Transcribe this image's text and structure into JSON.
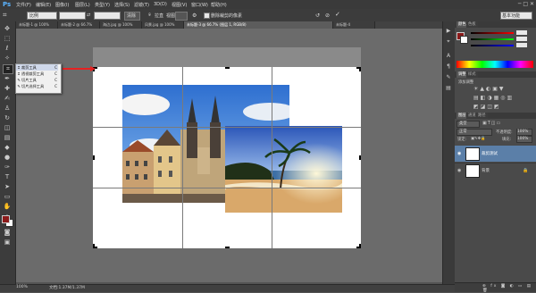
{
  "app": {
    "logo": "Ps"
  },
  "menu": [
    "文件(F)",
    "编辑(E)",
    "图像(I)",
    "图层(L)",
    "类型(Y)",
    "选择(S)",
    "滤镜(T)",
    "3D(D)",
    "视图(V)",
    "窗口(W)",
    "帮助(H)"
  ],
  "window_controls": "─ □ ✕",
  "options": {
    "ratio": "比例",
    "clear_label": "清除",
    "straighten_label": "拉直",
    "view_label": "视图",
    "delete_crop_label": "删除裁剪的像素",
    "confirm_icon": "check-icon",
    "cancel_icon": "cancel-icon",
    "reset_icon": "reset-icon",
    "mode_label": "基本功能"
  },
  "tabs": [
    {
      "label": "未标题-1 @ 100% (RGB/8)",
      "active": false
    },
    {
      "label": "未标题-2 @ 66.7% (RGB/8)",
      "active": false
    },
    {
      "label": "海边.jpg @ 100% (RGB/8)",
      "active": false
    },
    {
      "label": "风景.jpg @ 100% (RGB/8)",
      "active": false
    },
    {
      "label": "未标题-3 @ 66.7% (图层 1, RGB/8)",
      "active": true
    },
    {
      "label": "未标题-4",
      "active": false
    }
  ],
  "crop_flyout": {
    "items": [
      {
        "icon": "crop-icon",
        "glyph": "⌗",
        "label": "裁剪工具",
        "key": "C",
        "selected": true
      },
      {
        "icon": "perspective-crop-icon",
        "glyph": "⌗",
        "label": "透视裁剪工具",
        "key": "C",
        "selected": false
      },
      {
        "icon": "slice-icon",
        "glyph": "✎",
        "label": "切片工具",
        "key": "C",
        "selected": false
      },
      {
        "icon": "slice-select-icon",
        "glyph": "✎",
        "label": "切片选择工具",
        "key": "C",
        "selected": false
      }
    ]
  },
  "status": {
    "zoom": "100%",
    "doc": "文档:1.37M/1.37M"
  },
  "panels": {
    "color_tabs": [
      "颜色",
      "色板"
    ],
    "adjust_tabs": [
      "调整",
      "样式"
    ],
    "adjust_title": "添加调整",
    "layers_tabs": [
      "图层",
      "通道",
      "路径"
    ],
    "kind": "类型",
    "blend": "正常",
    "opacity_label": "不透明度:",
    "opacity": "100%",
    "lock_label": "锁定:",
    "fill_label": "填充:",
    "fill": "100%",
    "layers": [
      {
        "name": "裁剪测试",
        "selected": true
      },
      {
        "name": "背景",
        "selected": false
      }
    ],
    "layer_footer": "⊕ fx ◙ ◐ ▭ ▤ 🗑"
  },
  "colors": {
    "fg": "#8b1a1a",
    "bg": "#ffffff",
    "arrow": "#e62222"
  }
}
